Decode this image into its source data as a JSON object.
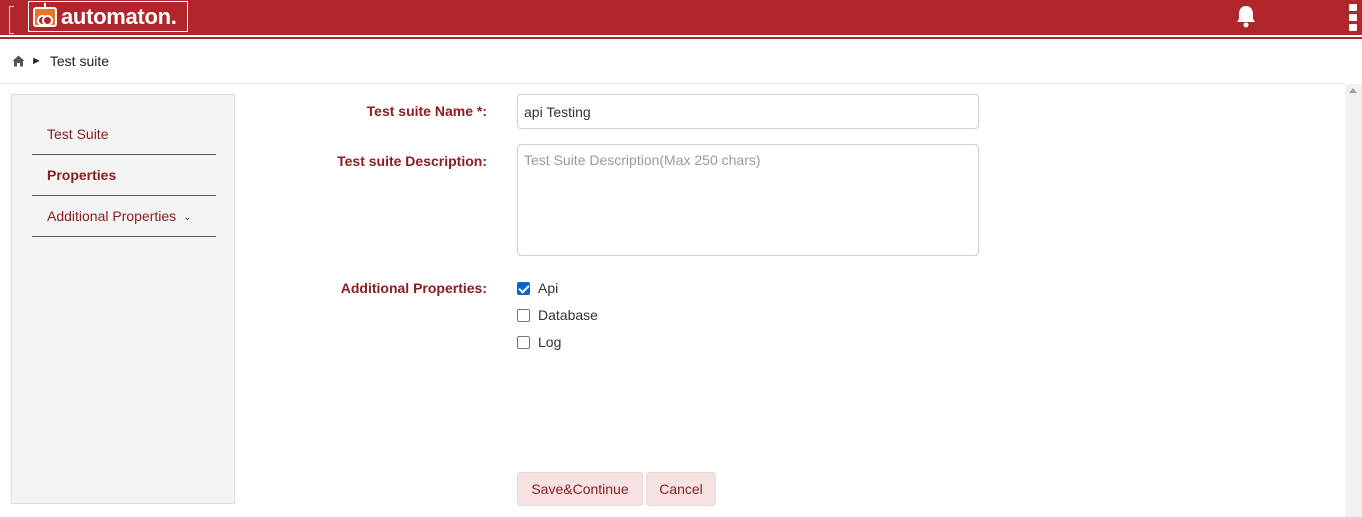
{
  "header": {
    "brand": "automaton.",
    "colors": {
      "bar": "#b0262b",
      "accent": "#8b1e22"
    },
    "icons": [
      "robot-logo-icon",
      "bell-icon",
      "kebab-menu-icon"
    ]
  },
  "breadcrumb": {
    "current": "Test suite"
  },
  "sidebar": {
    "items": [
      {
        "label": "Test Suite"
      },
      {
        "label": "Properties"
      },
      {
        "label": "Additional Properties"
      }
    ]
  },
  "form": {
    "name_label": "Test suite Name *:",
    "name_value": "api Testing",
    "desc_label": "Test suite Description:",
    "desc_value": "",
    "desc_placeholder": "Test Suite Description(Max 250 chars)",
    "props_label": "Additional Properties:",
    "options": [
      {
        "label": "Api",
        "checked": true
      },
      {
        "label": "Database",
        "checked": false
      },
      {
        "label": "Log",
        "checked": false
      }
    ]
  },
  "actions": {
    "save_label": "Save&Continue",
    "cancel_label": "Cancel"
  }
}
